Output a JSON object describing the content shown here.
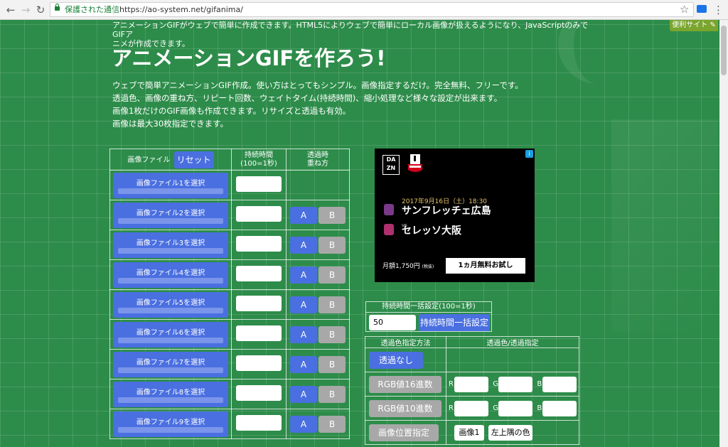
{
  "browser": {
    "secure_label": "保護された通信",
    "url": "https://ao-system.net/gifanima/"
  },
  "colors": {
    "accent_blue": "#4a6fe0",
    "page_green": "#2d8c4a",
    "badge_green": "#7aa52e"
  },
  "page": {
    "intro_line1": "アニメーションGIFがウェブで簡単に作成できます。HTML5によりウェブで簡単にローカル画像が扱えるようになり、JavaScriptのみでGIFア",
    "intro_line2": "ニメが作成できます。",
    "badge": "便利サイト",
    "title": "アニメーションGIFを作ろう!",
    "desc": [
      "ウェブで簡単アニメーションGIF作成。使い方はとってもシンプル。画像指定するだけ。完全無料、フリーです。",
      "透過色、画像の重ね方、リピート回数、ウェイトタイム(持続時間)、縮小処理など様々な設定が出来ます。",
      "画像1枚だけのGIF画像も作成できます。リサイズと透過も有効。",
      "画像は最大30枚指定できます。"
    ]
  },
  "files_table": {
    "col_file": "画像ファイル",
    "reset": "リセット",
    "col_duration_1": "持続時間",
    "col_duration_2": "(100=1秒)",
    "col_overlay_1": "透過時",
    "col_overlay_2": "重ね方",
    "opt_a": "A",
    "opt_b": "B",
    "rows": [
      "画像ファイル1を選択",
      "画像ファイル2を選択",
      "画像ファイル3を選択",
      "画像ファイル4を選択",
      "画像ファイル5を選択",
      "画像ファイル6を選択",
      "画像ファイル7を選択",
      "画像ファイル8を選択",
      "画像ファイル9を選択"
    ]
  },
  "ad": {
    "brand": "DAZN",
    "date": "2017年9月16日（土）18:30",
    "team1": "サンフレッチェ広島",
    "vs": "vs",
    "team2": "セレッソ大阪",
    "price": "月額1,750円",
    "tax": "(税抜)",
    "cta": "1ヵ月無料お試し"
  },
  "bulk": {
    "header": "持続時間一括設定(100=1秒)",
    "value": "50",
    "button": "持続時間一括設定"
  },
  "transparency": {
    "col_method": "透過色指定方法",
    "col_spec": "透過色/透過指定",
    "none": "透過なし",
    "hex": "RGB値16進数",
    "dec": "RGB値10進数",
    "pos": "画像位置指定",
    "r": "R",
    "g": "G",
    "b": "B",
    "image1": "画像1",
    "topleft": "左上隅の色"
  }
}
